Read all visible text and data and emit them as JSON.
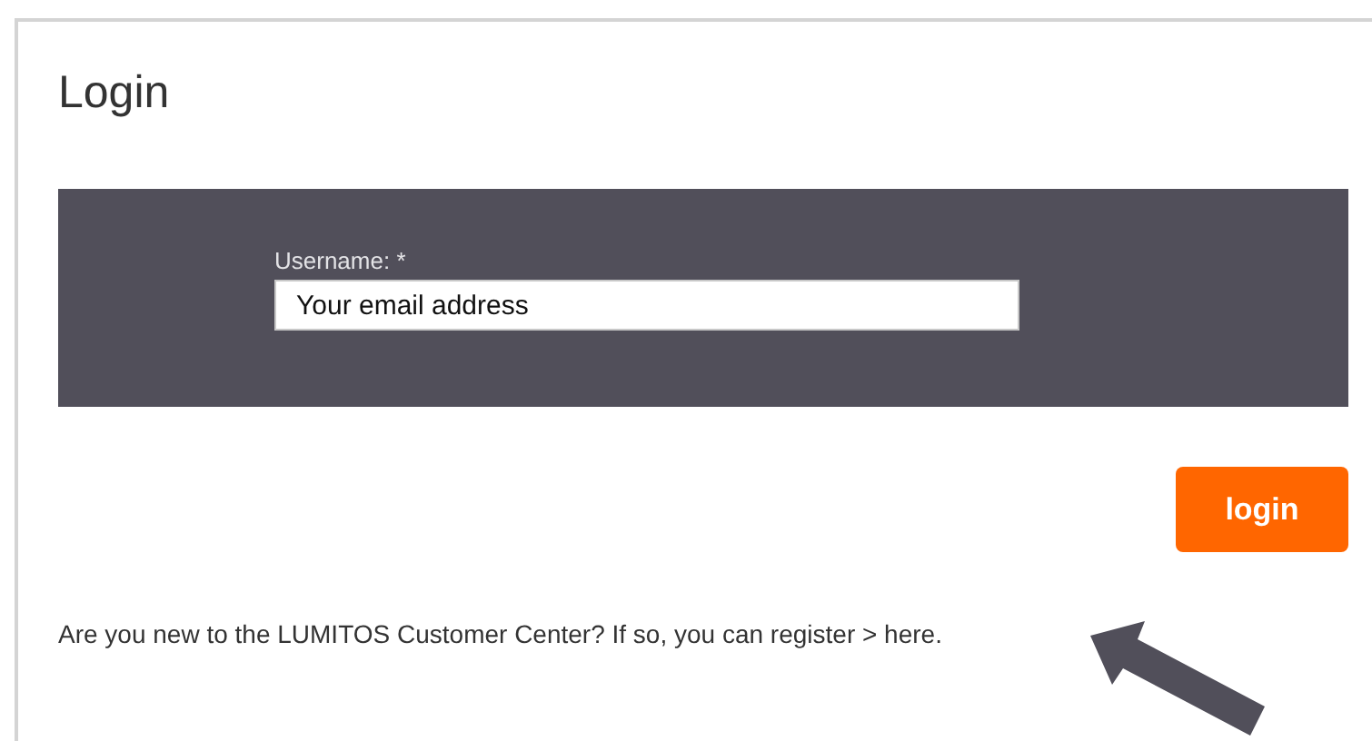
{
  "page": {
    "title": "Login"
  },
  "login_form": {
    "username": {
      "label": "Username: *",
      "value": "Your email address"
    }
  },
  "login_button": "login",
  "register_note": "Are you new to the LUMITOS Customer Center? If so, you can register > here."
}
